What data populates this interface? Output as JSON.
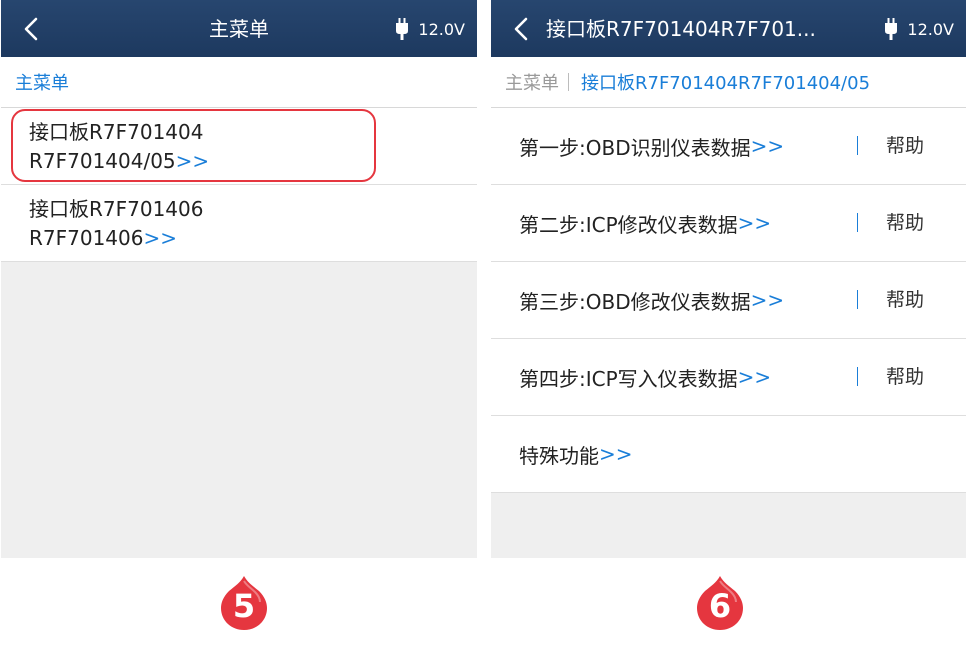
{
  "left_screen": {
    "title": "主菜单",
    "battery": "12.0V",
    "breadcrumb": "主菜单",
    "items": [
      {
        "line1": "接口板R7F701404",
        "line2": "R7F701404/05",
        "arrow": ">>"
      },
      {
        "line1": "接口板R7F701406",
        "line2": "R7F701406",
        "arrow": ">>"
      }
    ]
  },
  "right_screen": {
    "title": "接口板R7F701404R7F701...",
    "battery": "12.0V",
    "breadcrumb_root": "主菜单",
    "breadcrumb_current": "接口板R7F701404R7F701404/05",
    "steps": [
      {
        "label": "第一步:OBD识别仪表数据",
        "arrow": ">>",
        "help": "帮助"
      },
      {
        "label": "第二步:ICP修改仪表数据",
        "arrow": ">>",
        "help": "帮助"
      },
      {
        "label": "第三步:OBD修改仪表数据",
        "arrow": ">>",
        "help": "帮助"
      },
      {
        "label": "第四步:ICP写入仪表数据",
        "arrow": ">>",
        "help": "帮助"
      },
      {
        "label": "特殊功能",
        "arrow": ">>"
      }
    ]
  },
  "badges": {
    "left": "5",
    "right": "6",
    "color": "#e5363f"
  },
  "colors": {
    "header": "#1d395f",
    "link": "#1a7ed8",
    "highlight": "#e5363f"
  }
}
